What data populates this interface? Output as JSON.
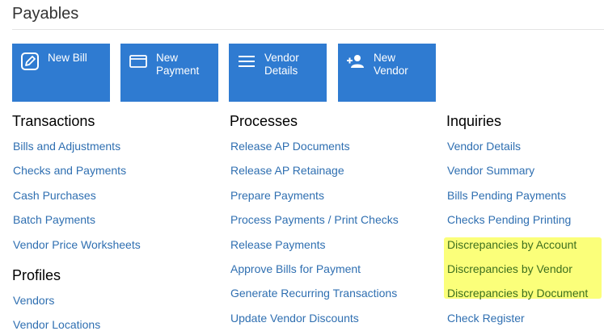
{
  "page": {
    "title": "Payables"
  },
  "tiles": [
    {
      "label": "New Bill",
      "icon": "edit-icon"
    },
    {
      "label": "New\nPayment",
      "icon": "card-icon"
    },
    {
      "label": "Vendor\nDetails",
      "icon": "list-icon"
    },
    {
      "label": "New\nVendor",
      "icon": "add-person-icon"
    }
  ],
  "transactions": {
    "heading": "Transactions",
    "items": [
      "Bills and Adjustments",
      "Checks and Payments",
      "Cash Purchases",
      "Batch Payments",
      "Vendor Price Worksheets"
    ]
  },
  "profiles": {
    "heading": "Profiles",
    "items": [
      "Vendors",
      "Vendor Locations"
    ]
  },
  "processes": {
    "heading": "Processes",
    "items": [
      "Release AP Documents",
      "Release AP Retainage",
      "Prepare Payments",
      "Process Payments / Print Checks",
      "Release Payments",
      "Approve Bills for Payment",
      "Generate Recurring Transactions",
      "Update Vendor Discounts"
    ]
  },
  "inquiries": {
    "heading": "Inquiries",
    "items": [
      "Vendor Details",
      "Vendor Summary",
      "Bills Pending Payments",
      "Checks Pending Printing",
      "Discrepancies by Account",
      "Discrepancies by Vendor",
      "Discrepancies by Document",
      "Check Register"
    ]
  },
  "colors": {
    "tile": "#2f7bd1",
    "link": "#2f6fb1",
    "highlight": "#fbff6b"
  }
}
